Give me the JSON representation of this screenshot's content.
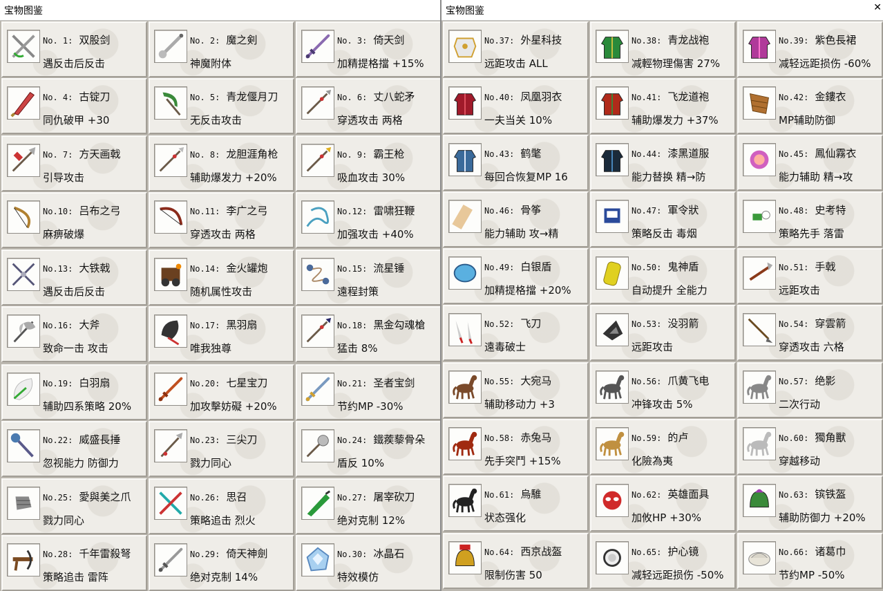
{
  "left_window": {
    "title": "宝物图鉴",
    "items": [
      {
        "no": "No. 1:",
        "name": "双股剑",
        "effect": "遇反击后反击",
        "icon": "twin-swords-icon"
      },
      {
        "no": "No. 2:",
        "name": "魔之剣",
        "effect": "神魔附体",
        "icon": "demon-sword-icon"
      },
      {
        "no": "No. 3:",
        "name": "倚天剑",
        "effect": "加精提格擋 +15%",
        "icon": "yitian-sword-icon"
      },
      {
        "no": "No. 4:",
        "name": "古锭刀",
        "effect": "同仇破甲 +30",
        "icon": "broadsword-icon"
      },
      {
        "no": "No. 5:",
        "name": "青龙偃月刀",
        "effect": "无反击攻击",
        "icon": "crescent-blade-icon"
      },
      {
        "no": "No. 6:",
        "name": "丈八蛇矛",
        "effect": "穿透攻击 两格",
        "icon": "snake-spear-icon"
      },
      {
        "no": "No. 7:",
        "name": "方天画戟",
        "effect": "引导攻击",
        "icon": "halberd-icon"
      },
      {
        "no": "No. 8:",
        "name": "龙胆涯角枪",
        "effect": "辅助爆发力 +20%",
        "icon": "dragon-spear-icon"
      },
      {
        "no": "No. 9:",
        "name": "霸王枪",
        "effect": "吸血攻击 30%",
        "icon": "overlord-spear-icon"
      },
      {
        "no": "No.10:",
        "name": "吕布之弓",
        "effect": "麻痹破爆",
        "icon": "lubu-bow-icon"
      },
      {
        "no": "No.11:",
        "name": "李广之弓",
        "effect": "穿透攻击 两格",
        "icon": "ligguang-bow-icon"
      },
      {
        "no": "No.12:",
        "name": "雷啸狂鞭",
        "effect": "加强攻击 +40%",
        "icon": "whip-icon"
      },
      {
        "no": "No.13:",
        "name": "大铁戟",
        "effect": "遇反击后反击",
        "icon": "iron-halberd-icon"
      },
      {
        "no": "No.14:",
        "name": "金火罐炮",
        "effect": "随机属性攻击",
        "icon": "fire-cannon-icon"
      },
      {
        "no": "No.15:",
        "name": "流星锤",
        "effect": "遠程封策",
        "icon": "meteor-hammer-icon"
      },
      {
        "no": "No.16:",
        "name": "大斧",
        "effect": "致命一击 攻击",
        "icon": "great-axe-icon"
      },
      {
        "no": "No.17:",
        "name": "黑羽扇",
        "effect": "唯我独尊",
        "icon": "black-fan-icon"
      },
      {
        "no": "No.18:",
        "name": "黑金勾魂槍",
        "effect": "猛击 8%",
        "icon": "black-spear-icon"
      },
      {
        "no": "No.19:",
        "name": "白羽扇",
        "effect": "辅助四系策略 20%",
        "icon": "white-fan-icon"
      },
      {
        "no": "No.20:",
        "name": "七星宝刀",
        "effect": "加攻擊妨礙 +20%",
        "icon": "seven-star-blade-icon"
      },
      {
        "no": "No.21:",
        "name": "圣者宝剑",
        "effect": "节约MP -30%",
        "icon": "holy-sword-icon"
      },
      {
        "no": "No.22:",
        "name": "威盛長捶",
        "effect": "忽视能力 防御力",
        "icon": "long-mace-icon"
      },
      {
        "no": "No.23:",
        "name": "三尖刀",
        "effect": "戮力同心",
        "icon": "trident-blade-icon"
      },
      {
        "no": "No.24:",
        "name": "鐵蒺藜骨朵",
        "effect": "盾反 10%",
        "icon": "spiked-mace-icon"
      },
      {
        "no": "No.25:",
        "name": "愛與美之爪",
        "effect": "戮力同心",
        "icon": "claw-icon"
      },
      {
        "no": "No.26:",
        "name": "思召",
        "effect": "策略追击 烈火",
        "icon": "sizhao-sword-icon"
      },
      {
        "no": "No.27:",
        "name": "屠宰砍刀",
        "effect": "绝对克制 12%",
        "icon": "butcher-knife-icon"
      },
      {
        "no": "No.28:",
        "name": "千年雷殺弩",
        "effect": "策略追击 雷阵",
        "icon": "crossbow-icon"
      },
      {
        "no": "No.29:",
        "name": "倚天神劍",
        "effect": "绝对克制 14%",
        "icon": "divine-sword-icon"
      },
      {
        "no": "No.30:",
        "name": "冰晶石",
        "effect": "特效模仿",
        "icon": "ice-crystal-icon"
      }
    ]
  },
  "right_window": {
    "title": "宝物图鉴",
    "close_label": "✕",
    "items": [
      {
        "no": "No.37:",
        "name": "外星科技",
        "effect": "远距攻击 ALL",
        "icon": "alien-armor-icon"
      },
      {
        "no": "No.38:",
        "name": "青龙战袍",
        "effect": "减輕物理傷害 27%",
        "icon": "green-robe-icon"
      },
      {
        "no": "No.39:",
        "name": "紫色長裙",
        "effect": "减轻远距损伤 -60%",
        "icon": "purple-dress-icon"
      },
      {
        "no": "No.40:",
        "name": "凤凰羽衣",
        "effect": "一夫当关 10%",
        "icon": "phoenix-robe-icon"
      },
      {
        "no": "No.41:",
        "name": "飞龙道袍",
        "effect": "辅助爆发力 +37%",
        "icon": "dragon-robe-icon"
      },
      {
        "no": "No.42:",
        "name": "金鏤衣",
        "effect": "MP辅助防御",
        "icon": "gold-armor-icon"
      },
      {
        "no": "No.43:",
        "name": "鹤氅",
        "effect": "每回合恢复MP 16",
        "icon": "crane-cloak-icon"
      },
      {
        "no": "No.44:",
        "name": "漆黑道服",
        "effect": "能力替换 精→防",
        "icon": "black-robe-icon"
      },
      {
        "no": "No.45:",
        "name": "鳳仙霧衣",
        "effect": "能力辅助 精→攻",
        "icon": "mist-robe-icon"
      },
      {
        "no": "No.46:",
        "name": "骨筝",
        "effect": "能力辅助 攻→精",
        "icon": "bone-zither-icon"
      },
      {
        "no": "No.47:",
        "name": "軍令狀",
        "effect": "策略反击 毒烟",
        "icon": "military-order-icon"
      },
      {
        "no": "No.48:",
        "name": "史考特",
        "effect": "策略先手 落雷",
        "icon": "scott-icon"
      },
      {
        "no": "No.49:",
        "name": "白银盾",
        "effect": "加精提格擋 +20%",
        "icon": "silver-shield-icon"
      },
      {
        "no": "No.50:",
        "name": "鬼神盾",
        "effect": "自动提升 全能力",
        "icon": "ghost-shield-icon"
      },
      {
        "no": "No.51:",
        "name": "手戟",
        "effect": "远距攻击",
        "icon": "hand-halberd-icon"
      },
      {
        "no": "No.52:",
        "name": "飞刀",
        "effect": "遠毒破士",
        "icon": "flying-knife-icon"
      },
      {
        "no": "No.53:",
        "name": "没羽箭",
        "effect": "远距攻击",
        "icon": "featherless-arrow-icon"
      },
      {
        "no": "No.54:",
        "name": "穿雲箭",
        "effect": "穿透攻击 六格",
        "icon": "cloud-arrow-icon"
      },
      {
        "no": "No.55:",
        "name": "大宛马",
        "effect": "辅助移动力 +3",
        "icon": "dawan-horse-icon"
      },
      {
        "no": "No.56:",
        "name": "爪黄飞电",
        "effect": "冲锋攻击 5%",
        "icon": "zhuahuang-horse-icon"
      },
      {
        "no": "No.57:",
        "name": "绝影",
        "effect": "二次行动",
        "icon": "jueying-horse-icon"
      },
      {
        "no": "No.58:",
        "name": "赤兔马",
        "effect": "先手突鬥 +15%",
        "icon": "red-hare-icon"
      },
      {
        "no": "No.59:",
        "name": "的卢",
        "effect": "化險為夷",
        "icon": "dilu-horse-icon"
      },
      {
        "no": "No.60:",
        "name": "獨角獸",
        "effect": "穿越移动",
        "icon": "unicorn-icon"
      },
      {
        "no": "No.61:",
        "name": "烏騅",
        "effect": "状态强化",
        "icon": "black-horse-icon"
      },
      {
        "no": "No.62:",
        "name": "英雄面具",
        "effect": "加攸HP +30%",
        "icon": "hero-mask-icon"
      },
      {
        "no": "No.63:",
        "name": "镔铁盔",
        "effect": "辅助防御力 +20%",
        "icon": "iron-helmet-icon"
      },
      {
        "no": "No.64:",
        "name": "西京战盔",
        "effect": "限制伤害 50",
        "icon": "war-helmet-icon"
      },
      {
        "no": "No.65:",
        "name": "护心镜",
        "effect": "减轻远距损伤 -50%",
        "icon": "heart-mirror-icon"
      },
      {
        "no": "No.66:",
        "name": "诸葛巾",
        "effect": "节约MP -50%",
        "icon": "zhuge-hat-icon"
      }
    ]
  },
  "colors": {
    "panel_bg": "#efede8",
    "titlebar_bg": "#ffffff",
    "frame": "#bcb8b0",
    "text": "#111111"
  }
}
